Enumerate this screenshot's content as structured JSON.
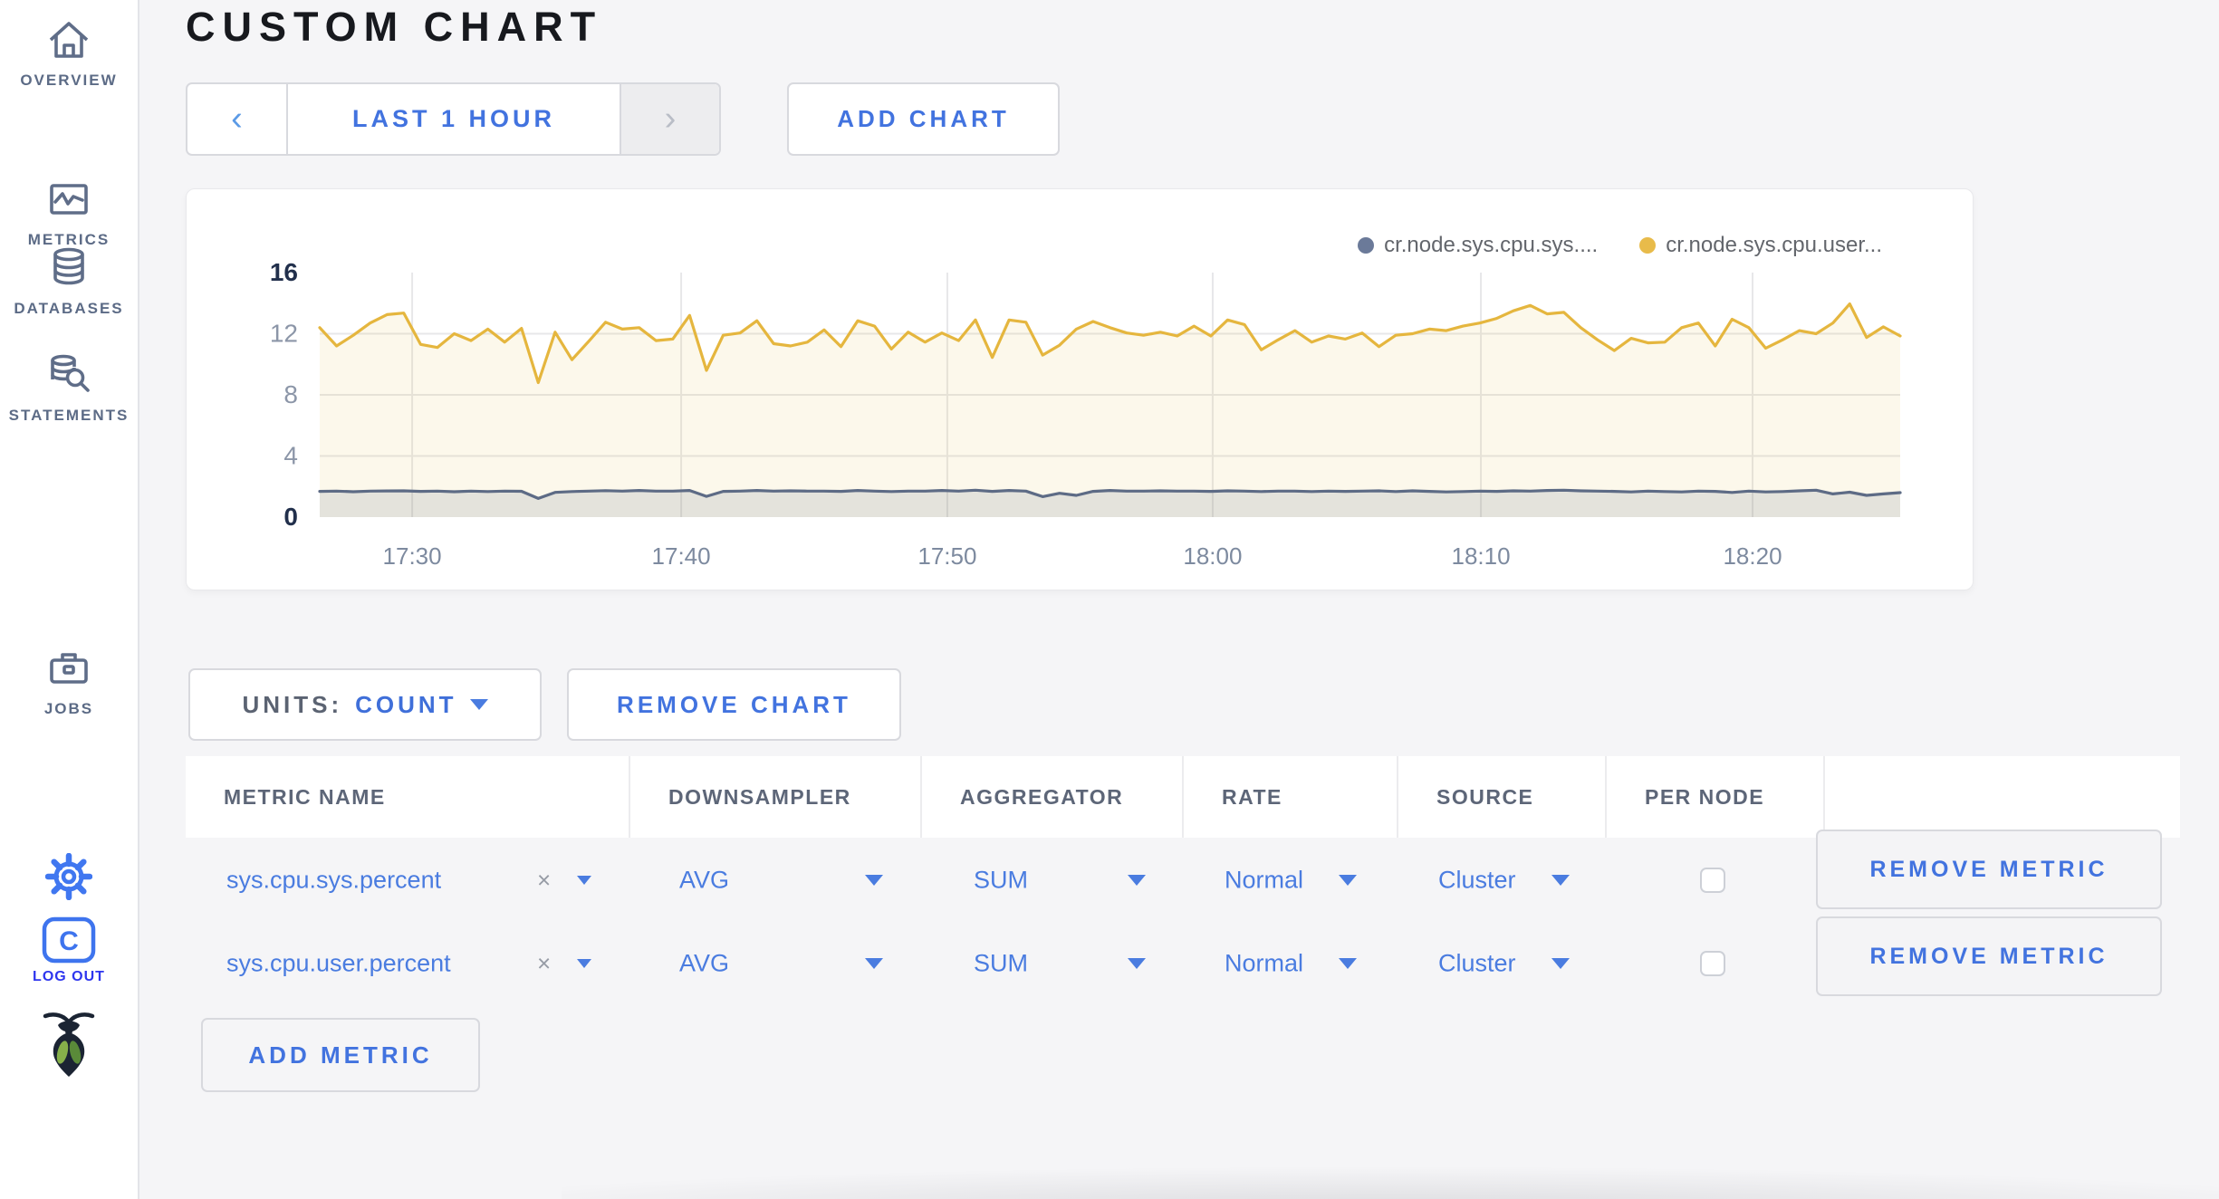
{
  "colors": {
    "accent_blue": "#4273df",
    "row_blue": "#4a7ce0",
    "logout_blue": "#2d35ee",
    "icon_blue": "#4077f0",
    "nav_slate": "#5c6b86"
  },
  "sidebar": {
    "items": [
      {
        "label": "OVERVIEW"
      },
      {
        "label": "METRICS"
      },
      {
        "label": "DATABASES"
      },
      {
        "label": "STATEMENTS"
      },
      {
        "label": "JOBS"
      }
    ],
    "logout_label": "LOG OUT",
    "logo_letter": "C"
  },
  "header": {
    "title": "CUSTOM CHART"
  },
  "toolbar": {
    "prev_arrow": "‹",
    "time_range": "LAST 1 HOUR",
    "next_arrow": "›",
    "add_chart": "ADD CHART"
  },
  "chart": {
    "legend": [
      {
        "label": "cr.node.sys.cpu.sys....",
        "color": "#6b7a99"
      },
      {
        "label": "cr.node.sys.cpu.user...",
        "color": "#e8bb4a"
      }
    ]
  },
  "chart_data": {
    "type": "area",
    "title": "",
    "ylim": [
      0,
      16
    ],
    "grid_on": true,
    "legend_position": "top-right",
    "y_ticks": [
      {
        "v": 16,
        "strong": true,
        "grid": false
      },
      {
        "v": 12,
        "strong": false,
        "grid": true
      },
      {
        "v": 8,
        "strong": false,
        "grid": true
      },
      {
        "v": 4,
        "strong": false,
        "grid": true
      },
      {
        "v": 0,
        "strong": true,
        "grid": false
      }
    ],
    "x_ticks": [
      {
        "label": "17:30",
        "frac": 0.0585
      },
      {
        "label": "17:40",
        "frac": 0.2287
      },
      {
        "label": "17:50",
        "frac": 0.3971
      },
      {
        "label": "18:00",
        "frac": 0.565
      },
      {
        "label": "18:10",
        "frac": 0.7347
      },
      {
        "label": "18:20",
        "frac": 0.9066
      }
    ],
    "grid_color": "#e7e7e9",
    "x_label_color": "#7d8a9f",
    "y_label_color": "#8c96a8",
    "y_label_strong_color": "#22304c",
    "series": [
      {
        "name": "cr.node.sys.cpu.user.percent",
        "color": "#e5b63e",
        "fill": "rgba(229,182,62,0.10)",
        "values": [
          12.4,
          11.2,
          11.9,
          12.7,
          13.25,
          13.35,
          11.3,
          11.1,
          12.0,
          11.55,
          12.3,
          11.45,
          12.35,
          8.8,
          12.1,
          10.3,
          11.5,
          12.75,
          12.3,
          12.4,
          11.55,
          11.65,
          13.2,
          9.6,
          11.9,
          12.05,
          12.85,
          11.35,
          11.2,
          11.45,
          12.25,
          11.15,
          12.85,
          12.5,
          11.0,
          12.1,
          11.45,
          12.05,
          11.55,
          12.9,
          10.45,
          12.9,
          12.75,
          10.6,
          11.25,
          12.3,
          12.8,
          12.4,
          12.05,
          11.9,
          12.1,
          11.85,
          12.5,
          11.85,
          12.9,
          12.6,
          10.95,
          11.6,
          12.2,
          11.45,
          11.85,
          11.65,
          12.05,
          11.15,
          11.9,
          12.0,
          12.3,
          12.2,
          12.5,
          12.7,
          13.0,
          13.5,
          13.85,
          13.3,
          13.4,
          12.4,
          11.6,
          10.9,
          11.7,
          11.4,
          11.45,
          12.4,
          12.7,
          11.2,
          12.95,
          12.4,
          11.05,
          11.6,
          12.2,
          12.0,
          12.7,
          13.95,
          11.75,
          12.45,
          11.85
        ]
      },
      {
        "name": "cr.node.sys.cpu.sys.percent",
        "color": "#5d6b85",
        "fill": "rgba(93,107,133,0.15)",
        "values": [
          1.68,
          1.7,
          1.66,
          1.7,
          1.71,
          1.72,
          1.68,
          1.7,
          1.66,
          1.7,
          1.67,
          1.7,
          1.69,
          1.22,
          1.62,
          1.67,
          1.7,
          1.73,
          1.7,
          1.74,
          1.7,
          1.7,
          1.74,
          1.36,
          1.68,
          1.7,
          1.74,
          1.7,
          1.72,
          1.7,
          1.7,
          1.68,
          1.74,
          1.7,
          1.67,
          1.7,
          1.7,
          1.74,
          1.7,
          1.76,
          1.68,
          1.74,
          1.7,
          1.34,
          1.56,
          1.42,
          1.68,
          1.74,
          1.7,
          1.7,
          1.72,
          1.7,
          1.7,
          1.68,
          1.72,
          1.7,
          1.67,
          1.7,
          1.7,
          1.67,
          1.7,
          1.68,
          1.7,
          1.72,
          1.67,
          1.72,
          1.68,
          1.65,
          1.67,
          1.7,
          1.68,
          1.72,
          1.7,
          1.74,
          1.76,
          1.72,
          1.7,
          1.68,
          1.65,
          1.7,
          1.67,
          1.65,
          1.7,
          1.68,
          1.61,
          1.7,
          1.65,
          1.67,
          1.72,
          1.76,
          1.52,
          1.63,
          1.42,
          1.52,
          1.6
        ]
      }
    ]
  },
  "units": {
    "label": "UNITS:",
    "value": "COUNT"
  },
  "actions": {
    "remove_chart": "REMOVE CHART",
    "add_metric": "ADD METRIC",
    "remove_metric": "REMOVE METRIC"
  },
  "table": {
    "columns": [
      "METRIC NAME",
      "DOWNSAMPLER",
      "AGGREGATOR",
      "RATE",
      "SOURCE",
      "PER NODE"
    ],
    "rows": [
      {
        "metric": "sys.cpu.sys.percent",
        "clear": "×",
        "downsampler": "AVG",
        "aggregator": "SUM",
        "rate": "Normal",
        "source": "Cluster",
        "per_node": false
      },
      {
        "metric": "sys.cpu.user.percent",
        "clear": "×",
        "downsampler": "AVG",
        "aggregator": "SUM",
        "rate": "Normal",
        "source": "Cluster",
        "per_node": false
      }
    ]
  }
}
